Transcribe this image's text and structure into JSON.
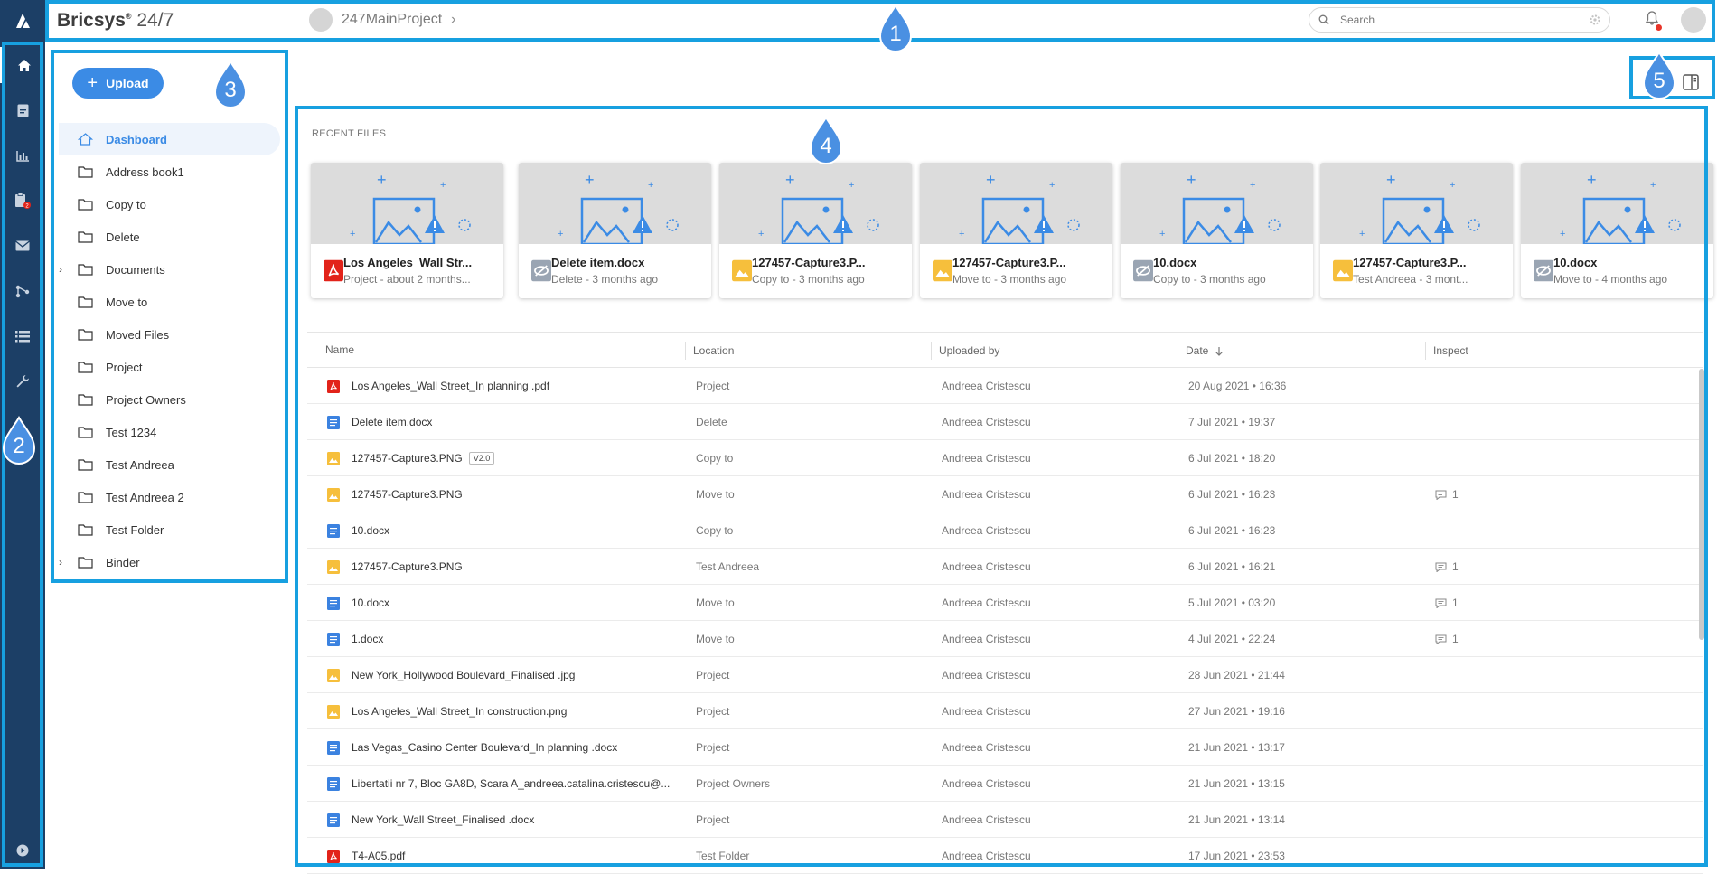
{
  "app": {
    "brand": "Bricsys",
    "reg_mark": "®",
    "brand_suffix": "24/7",
    "project_name": "247MainProject",
    "search_placeholder": "Search"
  },
  "rail": {
    "items": [
      "home-icon",
      "document-icon",
      "chart-icon",
      "clipboard-icon",
      "mail-icon",
      "workflow-icon",
      "list-icon",
      "wrench-icon",
      "play-circle-icon"
    ],
    "badge": "2"
  },
  "sidebar": {
    "upload_label": "Upload",
    "folders": [
      {
        "label": "Dashboard",
        "active": true,
        "expandable": false,
        "icon": "home-icon"
      },
      {
        "label": "Address book1",
        "expandable": false
      },
      {
        "label": "Copy to",
        "expandable": false
      },
      {
        "label": "Delete",
        "expandable": false
      },
      {
        "label": "Documents",
        "expandable": true
      },
      {
        "label": "Move to",
        "expandable": false
      },
      {
        "label": "Moved Files",
        "expandable": false
      },
      {
        "label": "Project",
        "expandable": false
      },
      {
        "label": "Project Owners",
        "expandable": false
      },
      {
        "label": "Test 1234",
        "expandable": false
      },
      {
        "label": "Test Andreea",
        "expandable": false
      },
      {
        "label": "Test Andreea 2",
        "expandable": false
      },
      {
        "label": "Test Folder",
        "expandable": false
      },
      {
        "label": "Binder",
        "expandable": true
      }
    ]
  },
  "callouts": [
    "1",
    "2",
    "3",
    "4",
    "5"
  ],
  "recent": {
    "label": "RECENT FILES",
    "cards": [
      {
        "name": "Los Angeles_Wall Str...",
        "sub": "Project - about 2 months...",
        "type": "pdf"
      },
      {
        "name": "Delete item.docx",
        "sub": "Delete - 3 months ago",
        "type": "hidden"
      },
      {
        "name": "127457-Capture3.P...",
        "sub": "Copy to - 3 months ago",
        "type": "image"
      },
      {
        "name": "127457-Capture3.P...",
        "sub": "Move to - 3 months ago",
        "type": "image"
      },
      {
        "name": "10.docx",
        "sub": "Copy to - 3 months ago",
        "type": "hidden"
      },
      {
        "name": "127457-Capture3.P...",
        "sub": "Test Andreea - 3 mont...",
        "type": "image"
      },
      {
        "name": "10.docx",
        "sub": "Move to - 4 months ago",
        "type": "hidden"
      }
    ]
  },
  "table": {
    "headers": {
      "name": "Name",
      "location": "Location",
      "uploaded_by": "Uploaded by",
      "date": "Date",
      "inspect": "Inspect"
    },
    "rows": [
      {
        "name": "Los Angeles_Wall Street_In planning .pdf",
        "type": "pdf",
        "location": "Project",
        "uploaded_by": "Andreea Cristescu",
        "date": "20 Aug 2021 • 16:36",
        "comments": ""
      },
      {
        "name": "Delete item.docx",
        "type": "doc",
        "location": "Delete",
        "uploaded_by": "Andreea Cristescu",
        "date": "7 Jul 2021 • 19:37",
        "comments": ""
      },
      {
        "name": "127457-Capture3.PNG",
        "type": "image",
        "version": "V2.0",
        "location": "Copy to",
        "uploaded_by": "Andreea Cristescu",
        "date": "6 Jul 2021 • 18:20",
        "comments": ""
      },
      {
        "name": "127457-Capture3.PNG",
        "type": "image",
        "location": "Move to",
        "uploaded_by": "Andreea Cristescu",
        "date": "6 Jul 2021 • 16:23",
        "comments": "1"
      },
      {
        "name": "10.docx",
        "type": "doc",
        "location": "Copy to",
        "uploaded_by": "Andreea Cristescu",
        "date": "6 Jul 2021 • 16:23",
        "comments": ""
      },
      {
        "name": "127457-Capture3.PNG",
        "type": "image",
        "location": "Test Andreea",
        "uploaded_by": "Andreea Cristescu",
        "date": "6 Jul 2021 • 16:21",
        "comments": "1"
      },
      {
        "name": "10.docx",
        "type": "doc",
        "location": "Move to",
        "uploaded_by": "Andreea Cristescu",
        "date": "5 Jul 2021 • 03:20",
        "comments": "1"
      },
      {
        "name": "1.docx",
        "type": "doc",
        "location": "Move to",
        "uploaded_by": "Andreea Cristescu",
        "date": "4 Jul 2021 • 22:24",
        "comments": "1"
      },
      {
        "name": "New York_Hollywood Boulevard_Finalised .jpg",
        "type": "image",
        "location": "Project",
        "uploaded_by": "Andreea Cristescu",
        "date": "28 Jun 2021 • 21:44",
        "comments": ""
      },
      {
        "name": "Los Angeles_Wall Street_In construction.png",
        "type": "image",
        "location": "Project",
        "uploaded_by": "Andreea Cristescu",
        "date": "27 Jun 2021 • 19:16",
        "comments": ""
      },
      {
        "name": "Las Vegas_Casino Center Boulevard_In planning .docx",
        "type": "doc",
        "location": "Project",
        "uploaded_by": "Andreea Cristescu",
        "date": "21 Jun 2021 • 13:17",
        "comments": ""
      },
      {
        "name": "Libertatii nr 7, Bloc GA8D, Scara A_andreea.catalina.cristescu@...",
        "type": "doc",
        "location": "Project Owners",
        "uploaded_by": "Andreea Cristescu",
        "date": "21 Jun 2021 • 13:15",
        "comments": ""
      },
      {
        "name": "New York_Wall Street_Finalised .docx",
        "type": "doc",
        "location": "Project",
        "uploaded_by": "Andreea Cristescu",
        "date": "21 Jun 2021 • 13:14",
        "comments": ""
      },
      {
        "name": "T4-A05.pdf",
        "type": "pdf",
        "location": "Test Folder",
        "uploaded_by": "Andreea Cristescu",
        "date": "17 Jun 2021 • 23:53",
        "comments": ""
      }
    ]
  },
  "colors": {
    "rail": "#1c3f66",
    "accent": "#3b8be5",
    "callout": "#17a0e0",
    "pdf": "#e2231a",
    "doc": "#3b82e0",
    "image": "#f6bf3c",
    "hidden": "#9aa5b3"
  }
}
